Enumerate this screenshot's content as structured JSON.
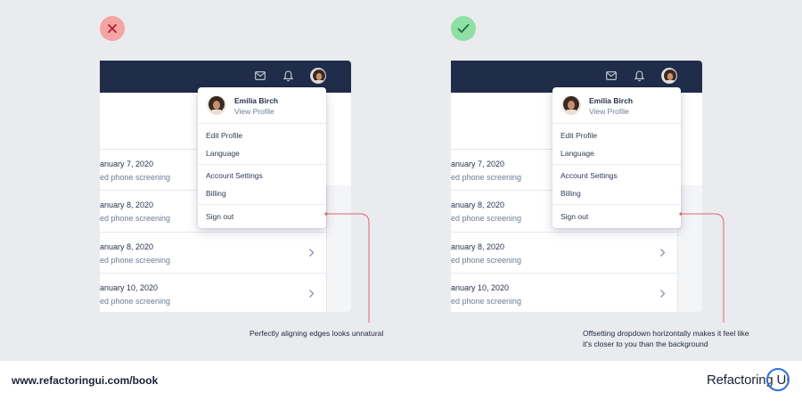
{
  "left_example": {
    "verdict": "incorrect",
    "icon": "x-icon",
    "rows": [
      {
        "date": "anuary 7, 2020",
        "sub": "ed phone screening"
      },
      {
        "date": "anuary 8, 2020",
        "sub": "ed phone screening"
      },
      {
        "date": "anuary 8, 2020",
        "sub": "ed phone screening"
      },
      {
        "date": "anuary 10, 2020",
        "sub": "ed phone screening"
      }
    ],
    "dropdown": {
      "name": "Emilia Birch",
      "view_profile": "View Profile",
      "items": [
        "Edit Profile",
        "Language",
        "Account Settings",
        "Billing",
        "Sign out"
      ]
    },
    "caption": "Perfectly aligning edges looks unnatural"
  },
  "right_example": {
    "verdict": "correct",
    "icon": "check-icon",
    "rows": [
      {
        "date": "anuary 7, 2020",
        "sub": "ed phone screening"
      },
      {
        "date": "anuary 8, 2020",
        "sub": "ed phone screening"
      },
      {
        "date": "anuary 8, 2020",
        "sub": "ed phone screening"
      },
      {
        "date": "anuary 10, 2020",
        "sub": "ed phone screening"
      }
    ],
    "dropdown": {
      "name": "Emilia Birch",
      "view_profile": "View Profile",
      "items": [
        "Edit Profile",
        "Language",
        "Account Settings",
        "Billing",
        "Sign out"
      ]
    },
    "caption_line1": "Offsetting dropdown horizontally makes it feel like",
    "caption_line2": "it's closer to you than the background"
  },
  "footer": {
    "url": "www.refactoringui.com/book",
    "brand": "Refactoring UI"
  },
  "colors": {
    "navbar": "#1f2d4a",
    "bad_badge": "#f6a3a3",
    "good_badge": "#8fe0a4",
    "callout": "#e0656b",
    "brand_ring": "#2f6fdb"
  }
}
